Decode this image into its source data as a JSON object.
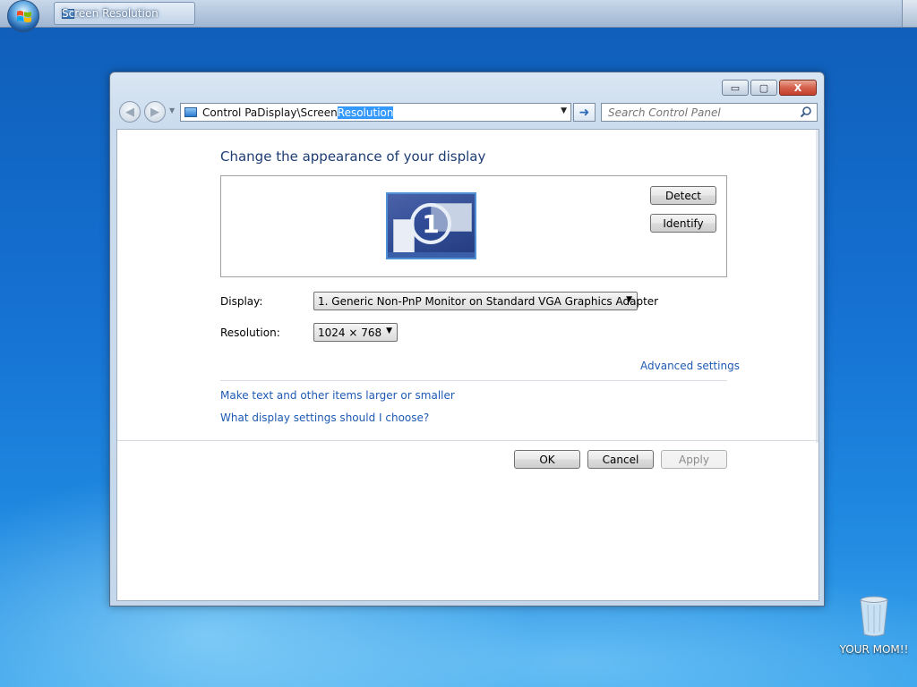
{
  "taskbar": {
    "active_task": "Screen Resolution"
  },
  "window": {
    "controls": {
      "minimize": "▭",
      "maximize": "▢",
      "close": "X"
    },
    "address": {
      "path_prefix": "Control PaDisplay\\Screen",
      "path_selected": "Resolution"
    },
    "search_placeholder": "Search Control Panel"
  },
  "main": {
    "heading": "Change the appearance of your display",
    "monitor_number": "1",
    "detect_label": "Detect",
    "identify_label": "Identify",
    "display_label": "Display:",
    "display_value": "1. Generic Non-PnP Monitor on Standard VGA Graphics Adapter",
    "resolution_label": "Resolution:",
    "resolution_value": "1024 × 768",
    "advanced_link": "Advanced settings",
    "link_text_size": "Make text and other items larger or smaller",
    "link_help": "What display settings should I choose?",
    "ok_label": "OK",
    "cancel_label": "Cancel",
    "apply_label": "Apply"
  },
  "desktop": {
    "recycle_bin_label": "YOUR MOM!!"
  },
  "colors": {
    "link": "#1e5ab3",
    "heading": "#1e3d73",
    "selection": "#3399ff"
  }
}
